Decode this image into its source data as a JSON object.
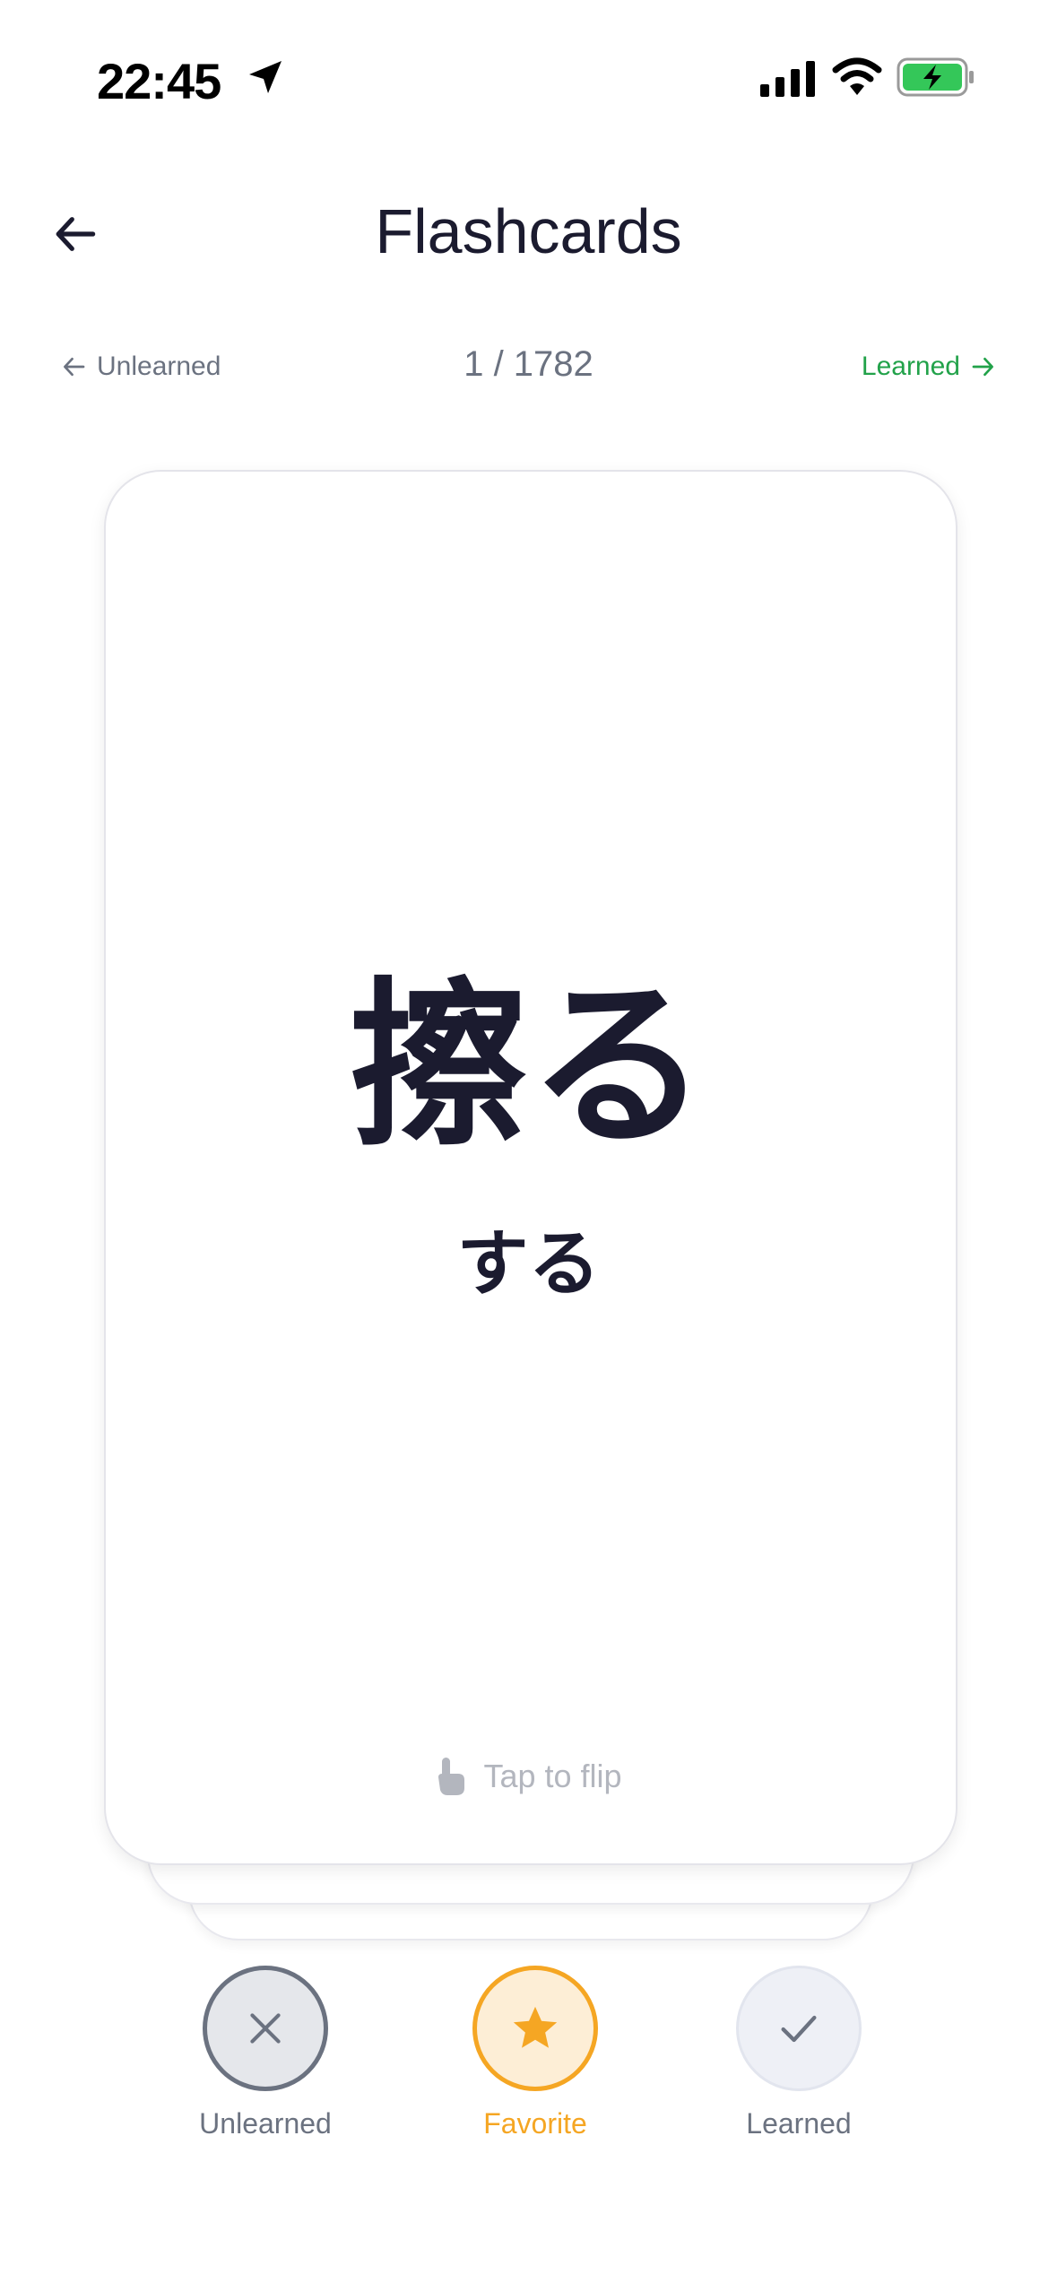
{
  "status_bar": {
    "time": "22:45",
    "icons": [
      "location-arrow-icon",
      "cellular-signal-icon",
      "wifi-icon",
      "battery-charging-icon"
    ],
    "battery_color": "#34c759"
  },
  "header": {
    "title": "Flashcards",
    "back_icon": "arrow-left-icon"
  },
  "nav": {
    "prev_label": "Unlearned",
    "next_label": "Learned",
    "counter": "1 / 1782",
    "next_color": "#22a24a"
  },
  "card": {
    "word": "擦る",
    "reading": "する",
    "hint": "Tap to flip",
    "hint_icon": "tap-hand-icon"
  },
  "actions": [
    {
      "label": "Unlearned",
      "icon": "close-x-icon"
    },
    {
      "label": "Favorite",
      "icon": "star-icon",
      "color": "#f5a623"
    },
    {
      "label": "Learned",
      "icon": "checkmark-icon"
    }
  ]
}
